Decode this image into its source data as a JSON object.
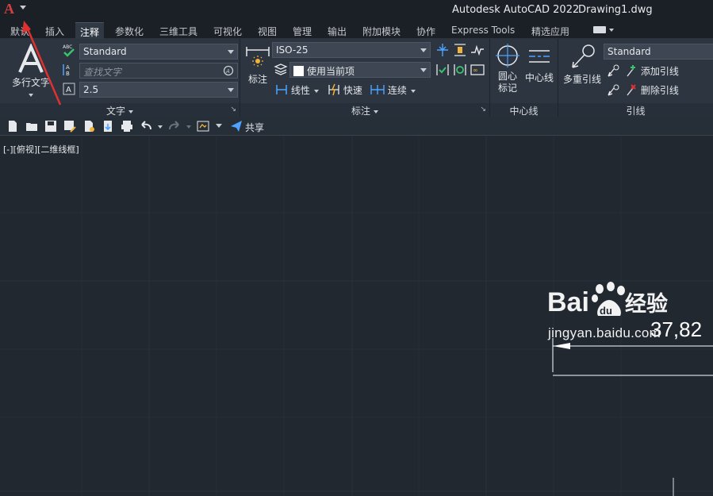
{
  "titlebar": {
    "logo": "A",
    "app_title": "Autodesk AutoCAD 2022",
    "document": "Drawing1.dwg"
  },
  "tabs": [
    "默认",
    "插入",
    "注释",
    "参数化",
    "三维工具",
    "可视化",
    "视图",
    "管理",
    "输出",
    "附加模块",
    "协作",
    "Express Tools",
    "精选应用"
  ],
  "active_tab": "注释",
  "ribbon": {
    "text_panel": {
      "big_button": "多行文字",
      "text_style": "Standard",
      "search_placeholder": "查找文字",
      "text_height": "2.5",
      "title": "文字"
    },
    "dim_panel": {
      "big_button": "标注",
      "dim_style": "ISO-25",
      "layer": "使用当前项",
      "linear": "线性",
      "quick": "快速",
      "continue": "连续",
      "title": "标注"
    },
    "centerline_panel": {
      "center_mark": "圆心\n标记",
      "center_mark_1": "圆心",
      "center_mark_2": "标记",
      "centerline": "中心线",
      "title": "中心线"
    },
    "leader_panel": {
      "big_button": "多重引线",
      "leader_style": "Standard",
      "add": "添加引线",
      "remove": "删除引线",
      "title": "引线"
    }
  },
  "qat": {
    "share": "共享"
  },
  "canvas": {
    "viewport_label": "[-][俯视][二维线框]",
    "dimension_value": "37,82"
  },
  "watermark": {
    "brand": "Baidu经验",
    "url": "jingyan.baidu.com"
  },
  "colors": {
    "accent_red": "#e03030",
    "background": "#212830",
    "ribbon": "#2d3540",
    "active_tab": "#2f3843"
  }
}
